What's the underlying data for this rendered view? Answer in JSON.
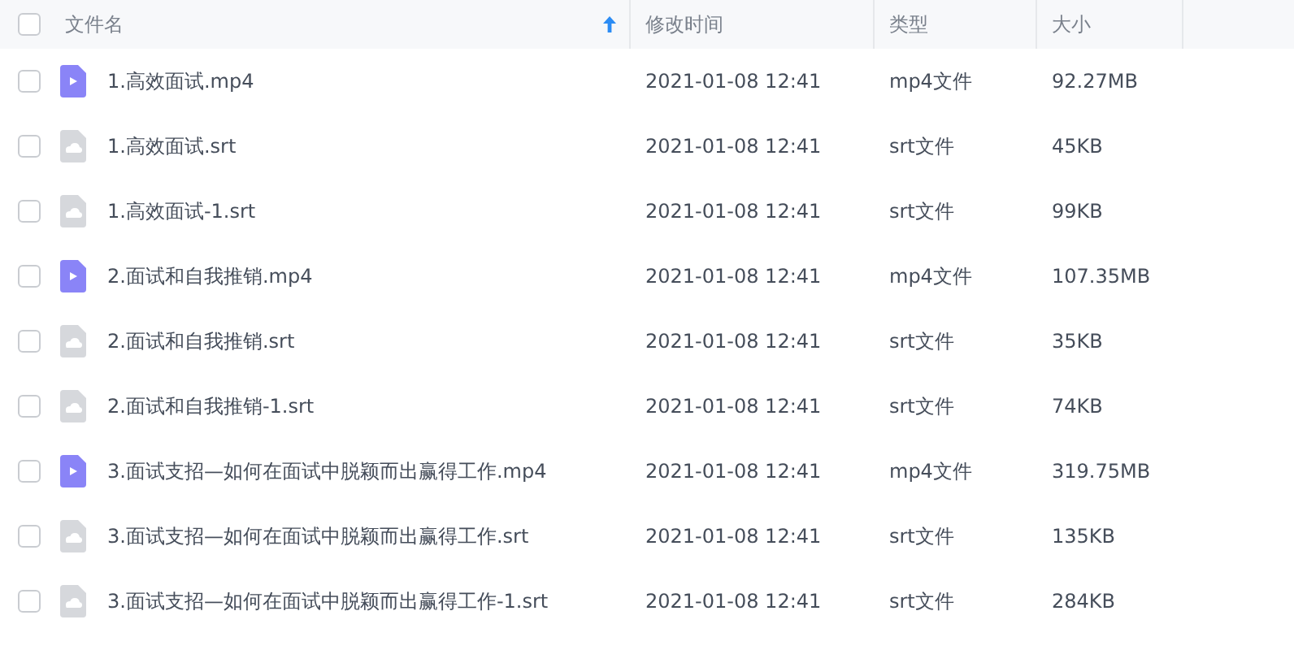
{
  "header": {
    "checked": false,
    "columns": [
      {
        "label": "文件名",
        "sorted_ascending": true
      },
      {
        "label": "修改时间",
        "sorted_ascending": false
      },
      {
        "label": "类型",
        "sorted_ascending": false
      },
      {
        "label": "大小",
        "sorted_ascending": false
      }
    ]
  },
  "rows": [
    {
      "kind": "video",
      "checked": false,
      "name": "1.高效面试.mp4",
      "modified": "2021-01-08 12:41",
      "type": "mp4文件",
      "size": "92.27MB"
    },
    {
      "kind": "document",
      "checked": false,
      "name": "1.高效面试.srt",
      "modified": "2021-01-08 12:41",
      "type": "srt文件",
      "size": "45KB"
    },
    {
      "kind": "document",
      "checked": false,
      "name": "1.高效面试-1.srt",
      "modified": "2021-01-08 12:41",
      "type": "srt文件",
      "size": "99KB"
    },
    {
      "kind": "video",
      "checked": false,
      "name": "2.面试和自我推销.mp4",
      "modified": "2021-01-08 12:41",
      "type": "mp4文件",
      "size": "107.35MB"
    },
    {
      "kind": "document",
      "checked": false,
      "name": "2.面试和自我推销.srt",
      "modified": "2021-01-08 12:41",
      "type": "srt文件",
      "size": "35KB"
    },
    {
      "kind": "document",
      "checked": false,
      "name": "2.面试和自我推销-1.srt",
      "modified": "2021-01-08 12:41",
      "type": "srt文件",
      "size": "74KB"
    },
    {
      "kind": "video",
      "checked": false,
      "name": "3.面试支招—如何在面试中脱颖而出赢得工作.mp4",
      "modified": "2021-01-08 12:41",
      "type": "mp4文件",
      "size": "319.75MB"
    },
    {
      "kind": "document",
      "checked": false,
      "name": "3.面试支招—如何在面试中脱颖而出赢得工作.srt",
      "modified": "2021-01-08 12:41",
      "type": "srt文件",
      "size": "135KB"
    },
    {
      "kind": "document",
      "checked": false,
      "name": "3.面试支招—如何在面试中脱颖而出赢得工作-1.srt",
      "modified": "2021-01-08 12:41",
      "type": "srt文件",
      "size": "284KB"
    }
  ]
}
